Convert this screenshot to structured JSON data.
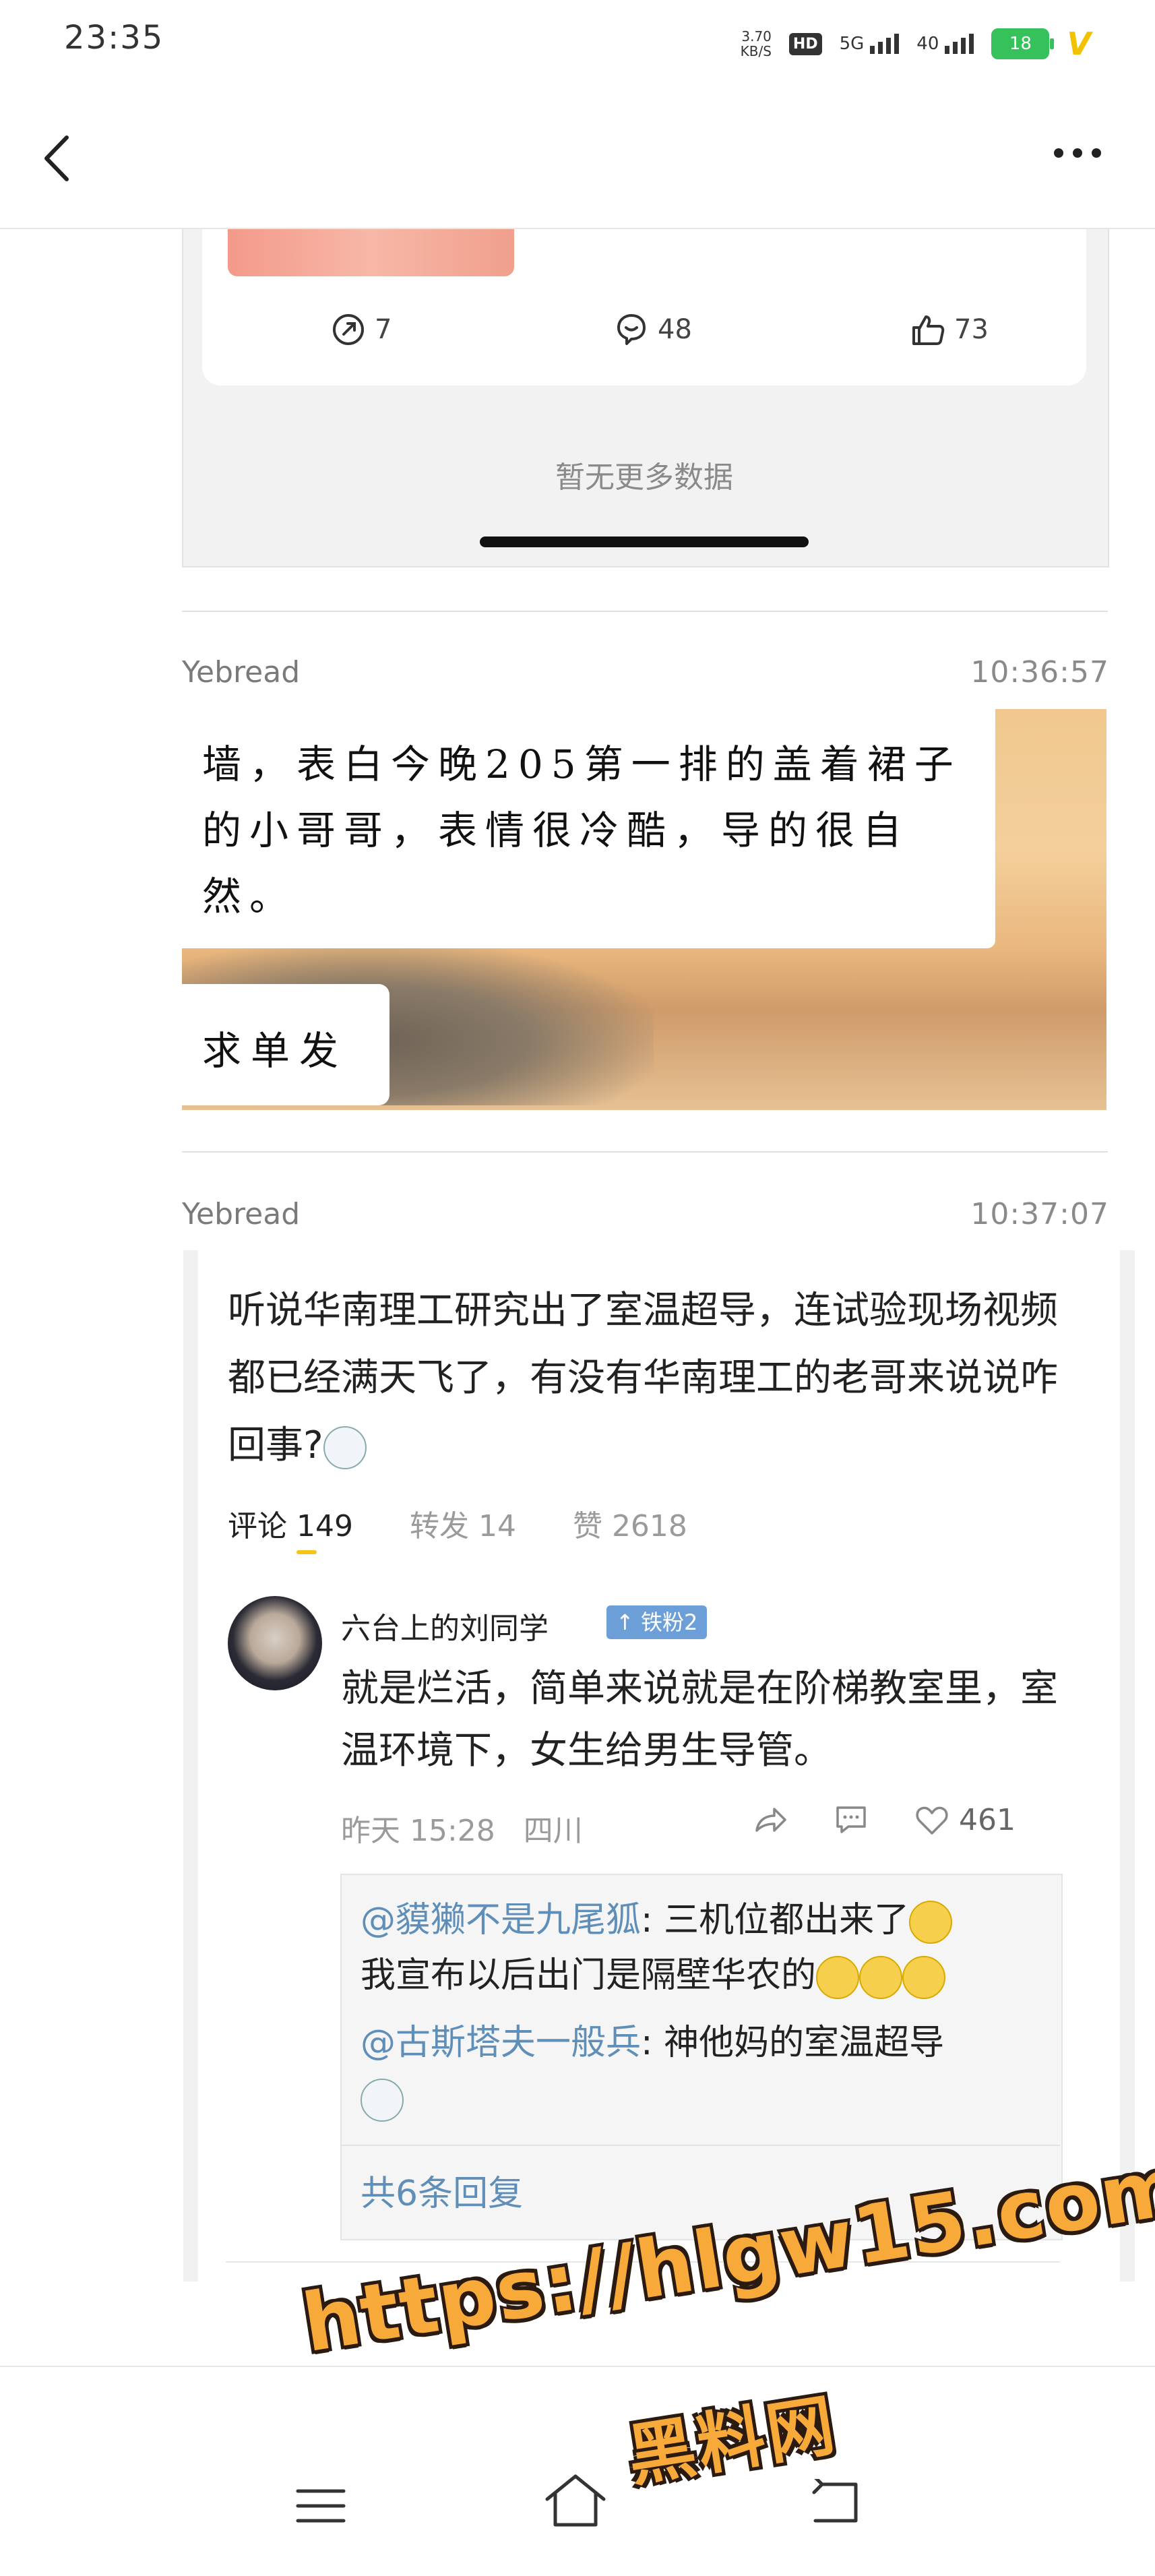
{
  "status_bar": {
    "time": "23:35",
    "net_speed_value": "3.70",
    "net_speed_unit": "KB/S",
    "hd": "HD",
    "signal1": "5G",
    "signal2": "40",
    "battery": "18"
  },
  "feed1": {
    "stats": {
      "reposts": "7",
      "comments": "48",
      "likes": "73"
    },
    "no_more": "暂无更多数据"
  },
  "messages": [
    {
      "sender": "Yebread",
      "time": "10:36:57",
      "note_text": "墙，表白今晚205第一排的盖着裙子的小哥哥，表情很冷酷，导的很自然。",
      "note_text2": "求单发"
    },
    {
      "sender": "Yebread",
      "time": "10:37:07"
    }
  ],
  "post": {
    "text": "听说华南理工研究出了室温超导，连试验现场视频都已经满天飞了，有没有华南理工的老哥来说说咋回事?",
    "tabs": {
      "comments": "评论 149",
      "reposts": "转发 14",
      "likes": "赞 2618"
    },
    "comment": {
      "user": "六台上的刘同学",
      "badge": "铁粉2",
      "text": "就是烂活，简单来说就是在阶梯教室里，室温环境下，女生给男生导管。",
      "time": "昨天 15:28",
      "location": "四川",
      "likes": "461",
      "replies": [
        {
          "user": "@貘獭不是九尾狐",
          "text": ": 三机位都出来了",
          "text2": "我宣布以后出门是隔壁华农的"
        },
        {
          "user": "@古斯塔夫一般兵",
          "text": ": 神他妈的室温超导"
        }
      ],
      "total_replies": "共6条回复"
    }
  },
  "watermark": {
    "line1": "https://hlgw15.com",
    "line2": "黑料网"
  },
  "colors": {
    "link_blue": "#5f8fb8",
    "badge_blue": "#6c9fd8",
    "battery_green": "#36c15a",
    "watermark_orange": "#f7a93a"
  }
}
